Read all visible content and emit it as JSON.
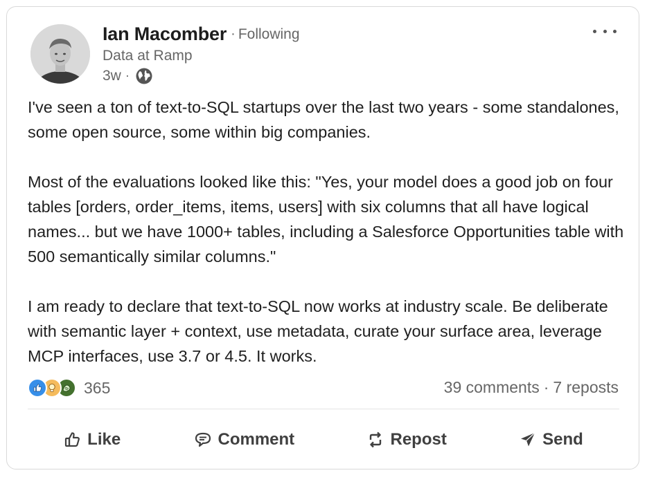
{
  "post": {
    "author": {
      "name": "Ian Macomber",
      "follow_status": "Following",
      "headline": "Data at Ramp",
      "time_ago": "3w",
      "visibility_icon": "globe-icon"
    },
    "menu_icon": "more-horizontal-icon",
    "body": [
      "I've seen a ton of text-to-SQL startups over the last two years - some standalones, some open source, some within big companies.",
      "Most of the evaluations looked like this: \"Yes, your model does a good job on four tables [orders, order_items, items, users] with six columns that all have logical names... but we have 1000+ tables, including a Salesforce Opportunities table with 500 semantically similar columns.\"",
      "I am ready to declare that text-to-SQL now works at industry scale. Be deliberate with semantic layer + context, use metadata, curate your surface area, leverage MCP interfaces, use 3.7 or 4.5. It works."
    ],
    "reactions": {
      "types": [
        "like-icon",
        "insightful-icon",
        "support-icon"
      ],
      "count": "365"
    },
    "comments": "39 comments",
    "reposts": "7 reposts",
    "separator": "·"
  },
  "actions": {
    "like": "Like",
    "comment": "Comment",
    "repost": "Repost",
    "send": "Send"
  },
  "colors": {
    "text_primary": "#1f1f1f",
    "text_secondary": "#666666",
    "like_blue": "#378fe9",
    "insight_yellow": "#f5bb5c",
    "support_green": "#44712e",
    "border": "#d9d9d9"
  }
}
